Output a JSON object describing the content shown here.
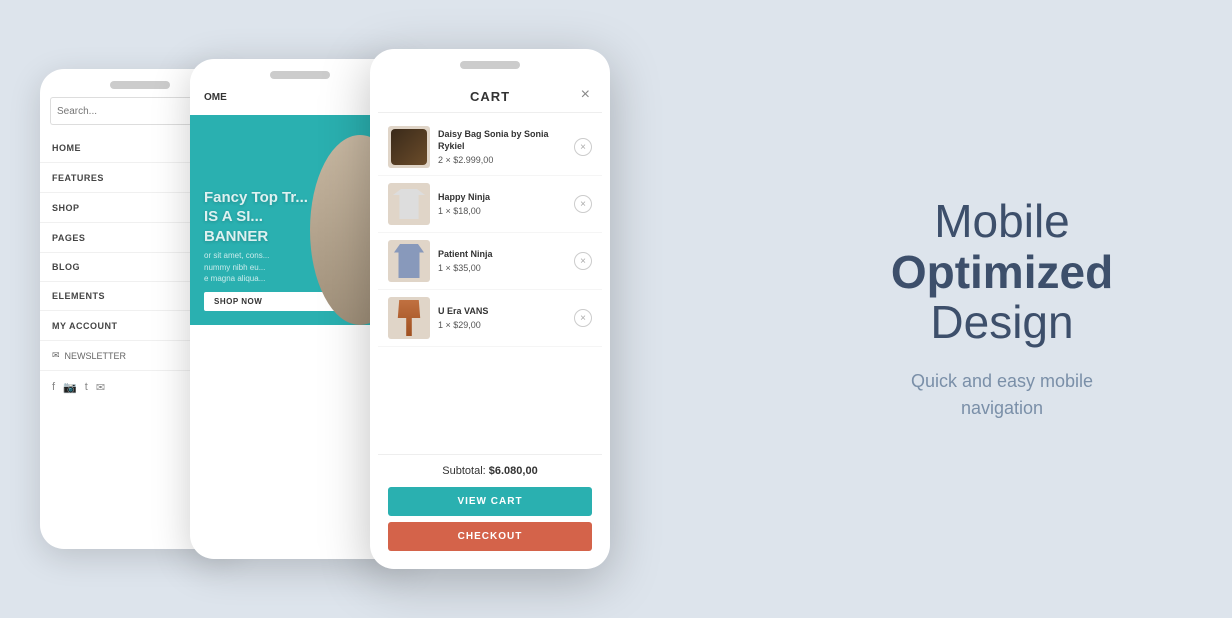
{
  "background_color": "#dde4ec",
  "promo": {
    "line1": "Mobile",
    "line2": "Optimized",
    "line3": "Design",
    "subtitle": "Quick and easy mobile\nnavigation"
  },
  "nav_phone": {
    "search_placeholder": "Search...",
    "items": [
      {
        "label": "HOME",
        "has_chevron": true
      },
      {
        "label": "FEATURES",
        "has_chevron": true
      },
      {
        "label": "SHOP",
        "has_chevron": true
      },
      {
        "label": "PAGES",
        "has_chevron": true
      },
      {
        "label": "BLOG",
        "has_chevron": false
      },
      {
        "label": "ELEMENTS",
        "has_chevron": false
      },
      {
        "label": "MY ACCOUNT",
        "has_chevron": true
      }
    ],
    "newsletter_label": "NEWSLETTER",
    "social_icons": [
      "f",
      "ig",
      "tw",
      "em"
    ]
  },
  "banner_phone": {
    "logo": "OME",
    "banner_text": "Fancy Top Tr...",
    "banner_sub1": "IS A SI...",
    "banner_sub2": "BANNER",
    "body_text": "or sit amet, cons...\nnummy nibh eu...\ne magna aliqua...",
    "shop_now": "SHOP NOW"
  },
  "cart_modal": {
    "title": "CART",
    "close_label": "×",
    "items": [
      {
        "name": "Daisy Bag Sonia by Sonia Rykiel",
        "qty": "2",
        "price": "$2.999,00",
        "img_type": "bag"
      },
      {
        "name": "Happy Ninja",
        "qty": "1",
        "price": "$18,00",
        "img_type": "shirt"
      },
      {
        "name": "Patient Ninja",
        "qty": "1",
        "price": "$35,00",
        "img_type": "hoodie"
      },
      {
        "name": "U Era VANS",
        "qty": "1",
        "price": "$29,00",
        "img_type": "pants"
      }
    ],
    "subtotal_label": "Subtotal:",
    "subtotal_value": "$6.080,00",
    "view_cart_label": "VIEW CART",
    "checkout_label": "CHECKOUT"
  }
}
